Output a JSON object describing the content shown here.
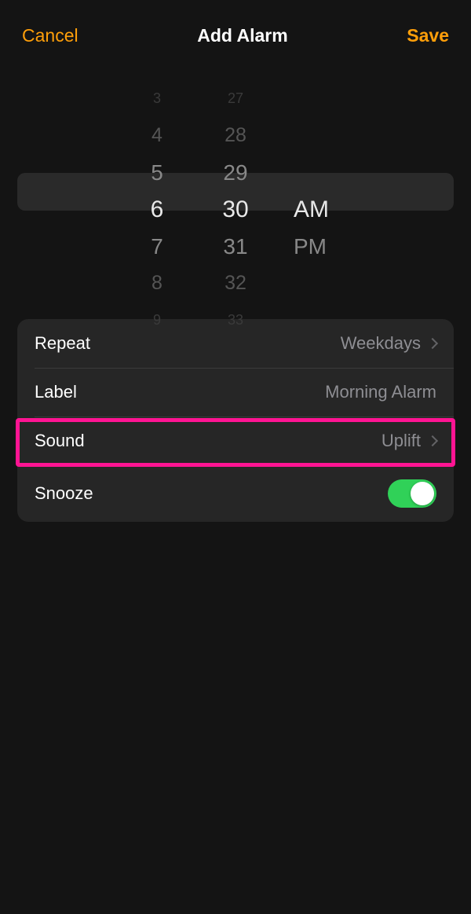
{
  "header": {
    "cancel_label": "Cancel",
    "title": "Add Alarm",
    "save_label": "Save"
  },
  "picker": {
    "hours_above": [
      "3",
      "4",
      "5"
    ],
    "hours_selected": "6",
    "hours_below": [
      "7",
      "8",
      "9"
    ],
    "minutes_above": [
      "27",
      "28",
      "29"
    ],
    "minutes_selected": "30",
    "minutes_below": [
      "31",
      "32",
      "33"
    ],
    "ampm_selected": "AM",
    "ampm_other": "PM"
  },
  "settings": {
    "repeat_label": "Repeat",
    "repeat_value": "Weekdays",
    "label_label": "Label",
    "label_value": "Morning Alarm",
    "sound_label": "Sound",
    "sound_value": "Uplift",
    "snooze_label": "Snooze",
    "snooze_on": true
  }
}
